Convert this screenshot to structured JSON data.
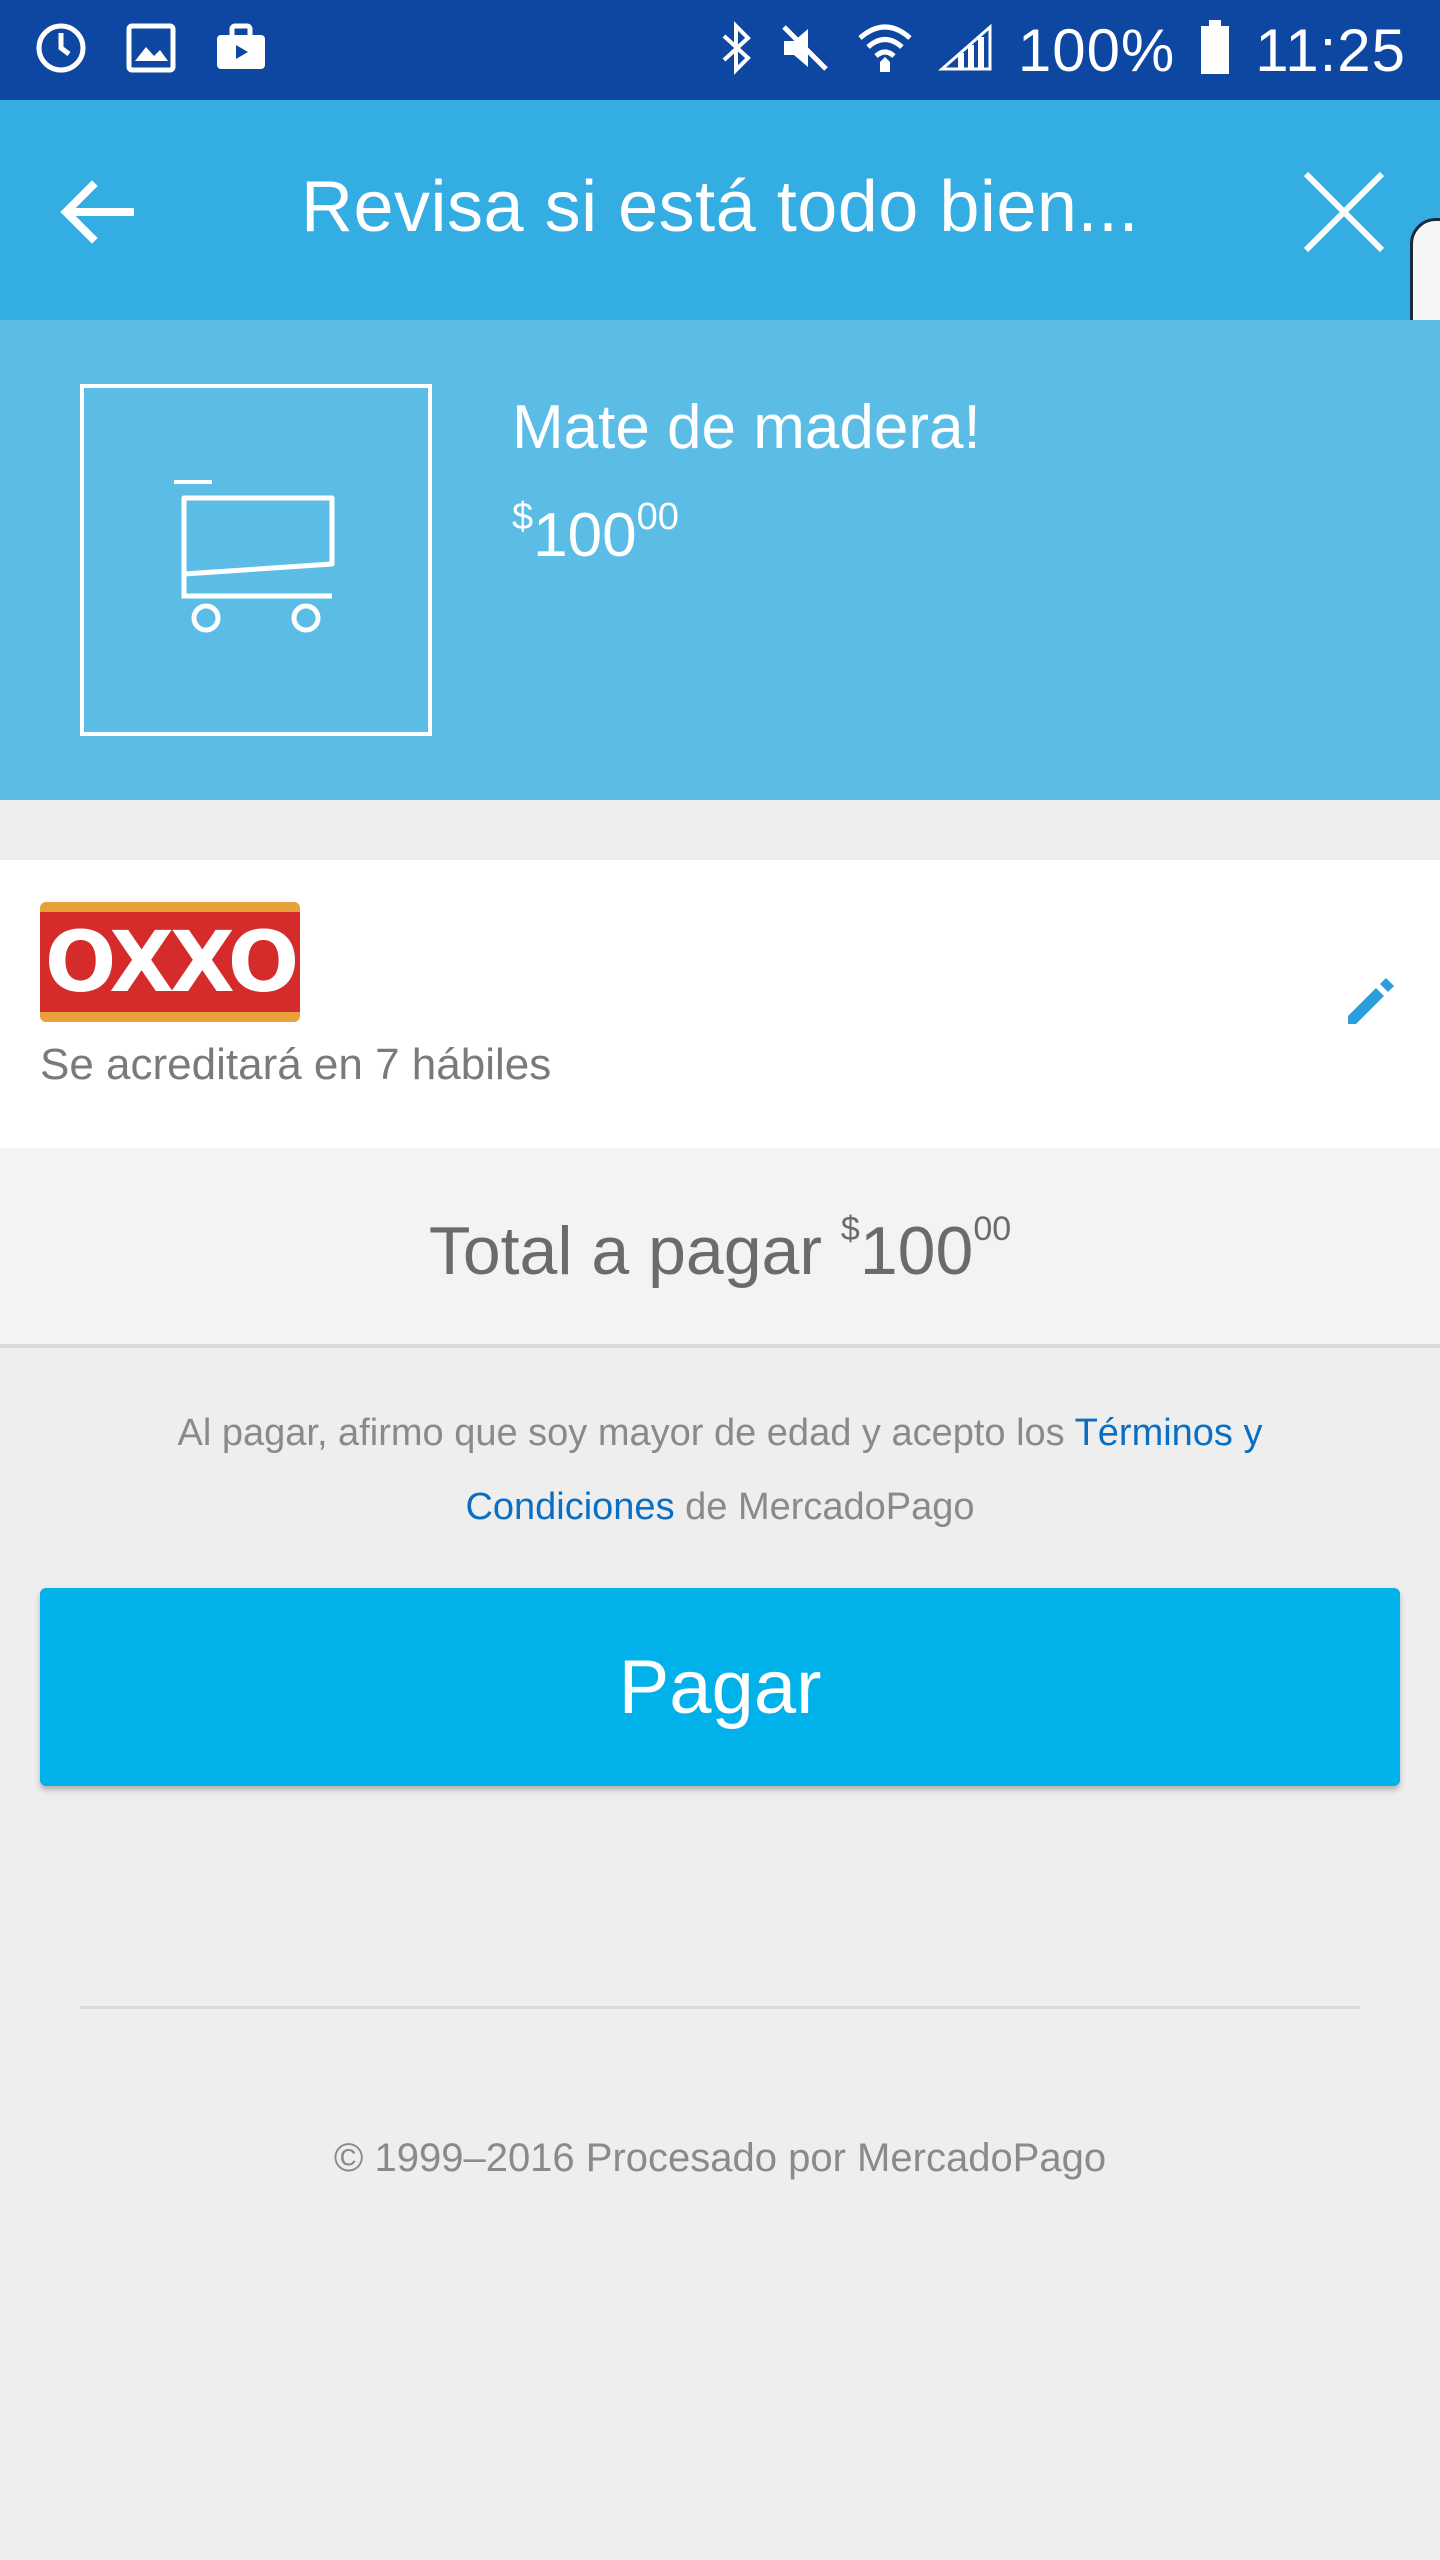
{
  "status_bar": {
    "left_icons": [
      "sync-icon",
      "gallery-icon",
      "briefcase-icon"
    ],
    "right_icons": [
      "bluetooth-icon",
      "mute-icon",
      "wifi-icon",
      "signal-icon"
    ],
    "battery": "100%",
    "time": "11:25"
  },
  "toolbar": {
    "title": "Revisa si está todo bien...",
    "back_icon": "arrow-back-icon",
    "close_icon": "close-icon"
  },
  "product": {
    "name": "Mate de madera!",
    "price_currency": "$",
    "price_int": "100",
    "price_cents": "00",
    "thumb_icon": "cart-icon"
  },
  "payment": {
    "method_logo": "OXXO",
    "subtitle": "Se acreditará en 7 hábiles",
    "edit_icon": "pencil-icon"
  },
  "total": {
    "label": "Total a pagar",
    "currency": "$",
    "int": "100",
    "cents": "00"
  },
  "terms": {
    "prefix": "Al pagar, afirmo que soy mayor de edad y acepto los",
    "link": "Términos y Condiciones",
    "suffix": "de MercadoPago"
  },
  "pay_button": {
    "label": "Pagar"
  },
  "footer": {
    "text": "© 1999–2016 Procesado por MercadoPago"
  },
  "colors": {
    "status_bar": "#0d47a1",
    "toolbar": "#33ade2",
    "product_band": "#5bbde6",
    "pay_button": "#00b1ea",
    "link": "#0a6fc2",
    "oxxo_red": "#d52b2b",
    "oxxo_yellow": "#e8a13a"
  }
}
